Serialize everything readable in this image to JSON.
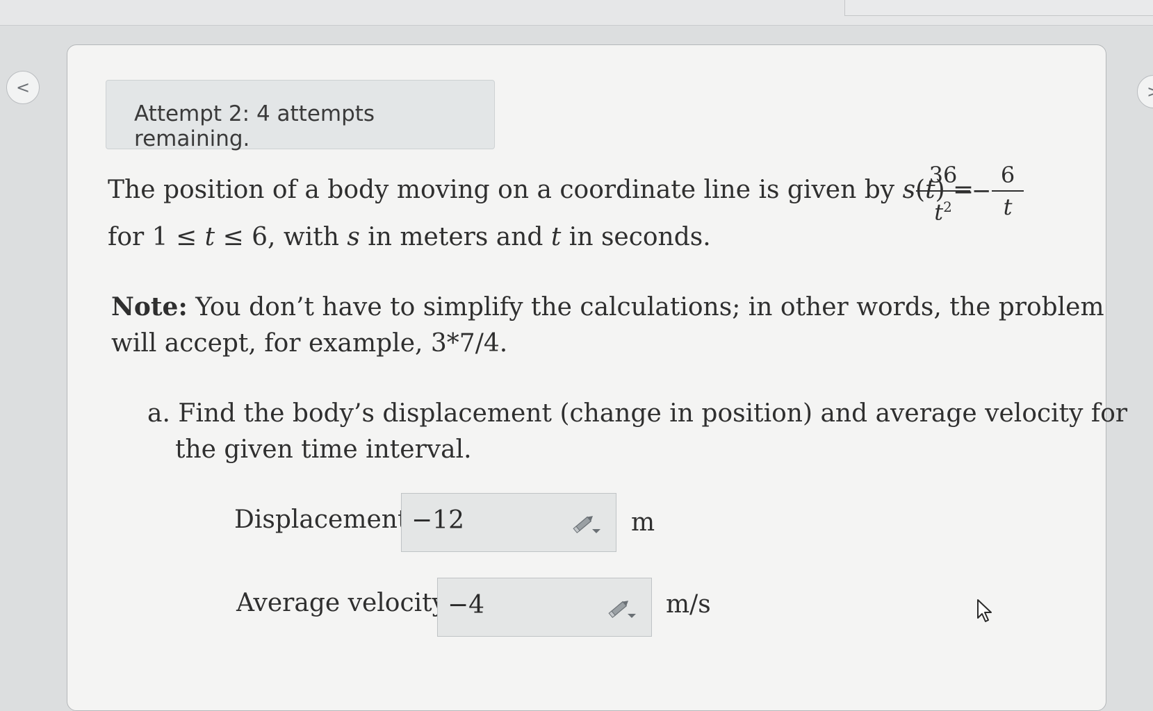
{
  "navigation": {
    "prev_glyph": "<",
    "next_glyph": ">"
  },
  "attempt_banner": "Attempt 2: 4 attempts remaining.",
  "problem": {
    "line1_text": "The position of a body moving on a coordinate line is given by ",
    "function_name": "s",
    "function_var": "t",
    "function_eq": ") =",
    "frac1_num": "36",
    "frac1_den": "t",
    "frac1_den_exp": "2",
    "minus": "−",
    "frac2_num": "6",
    "frac2_den": "t",
    "line2_pre": "for 1 ≤ ",
    "line2_var1": "t",
    "line2_mid": " ≤ 6, with ",
    "line2_var2": "s",
    "line2_mid2": " in meters and ",
    "line2_var3": "t",
    "line2_post": " in seconds."
  },
  "note": {
    "label": "Note:",
    "line1": " You don’t have to simplify the calculations; in other words, the problem",
    "line2": "will accept, for example, 3*7/4."
  },
  "part_a": {
    "marker": "a.",
    "line1": " Find the body’s displacement (change in position) and average velocity for",
    "line2": "the given time interval."
  },
  "displacement": {
    "label": "Displacement:",
    "value": "−12",
    "unit": "m"
  },
  "average_velocity": {
    "label": "Average velocity:",
    "value": "−4",
    "unit": "m/s"
  },
  "icons": [
    "chevron-left-icon",
    "chevron-right-icon",
    "pencil-dropdown-icon",
    "mouse-pointer-icon"
  ]
}
